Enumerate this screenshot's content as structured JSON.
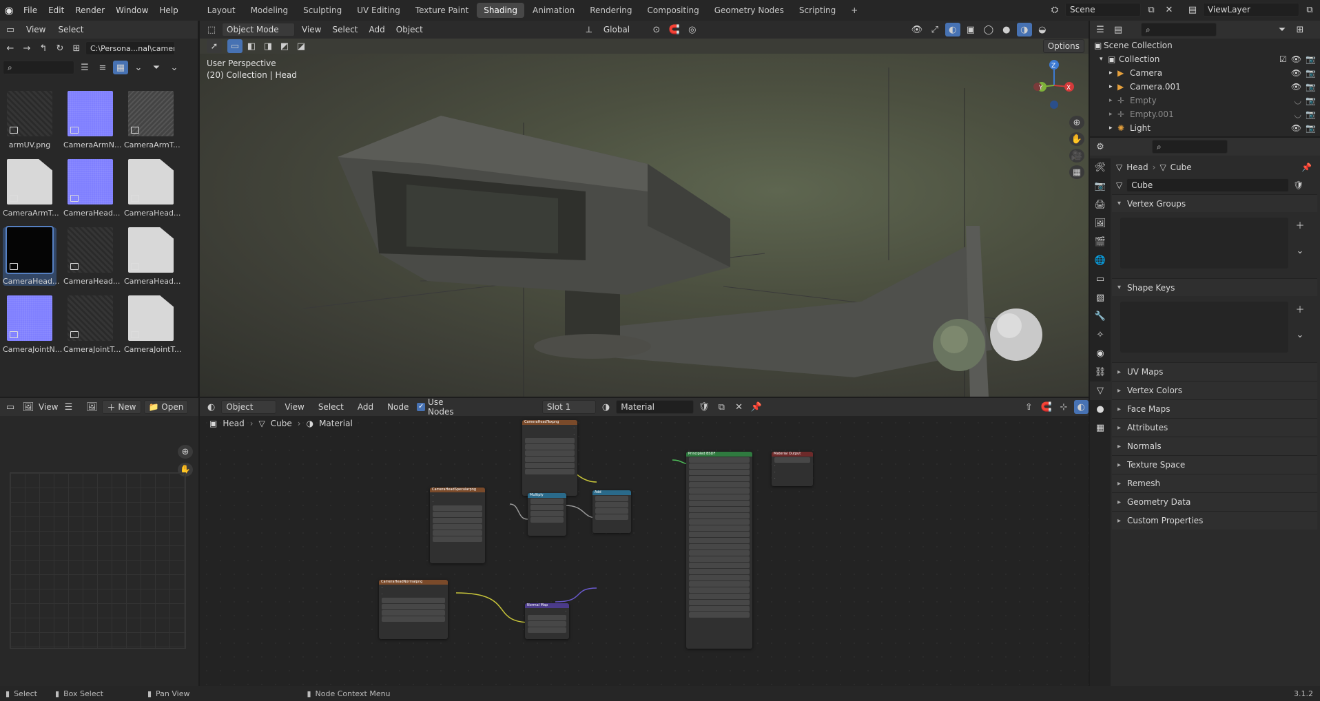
{
  "topbar": {
    "menus": [
      "File",
      "Edit",
      "Render",
      "Window",
      "Help"
    ],
    "workspaces": [
      "Layout",
      "Modeling",
      "Sculpting",
      "UV Editing",
      "Texture Paint",
      "Shading",
      "Animation",
      "Rendering",
      "Compositing",
      "Geometry Nodes",
      "Scripting"
    ],
    "active_workspace": "Shading",
    "add_tab": "+",
    "scene": "Scene",
    "view_layer": "ViewLayer"
  },
  "file_browser": {
    "menus": [
      "View",
      "Select"
    ],
    "path": "C:\\Persona...nal\\camera\\",
    "files": [
      {
        "name": "armUV.png",
        "kind": "dark"
      },
      {
        "name": "CameraArmN...",
        "kind": "normal"
      },
      {
        "name": "CameraArmT...",
        "kind": "greyish"
      },
      {
        "name": "CameraArmT...",
        "kind": "doc"
      },
      {
        "name": "CameraHead...",
        "kind": "normal"
      },
      {
        "name": "CameraHead...",
        "kind": "doc"
      },
      {
        "name": "CameraHead...",
        "kind": "selected"
      },
      {
        "name": "CameraHead...",
        "kind": "dark"
      },
      {
        "name": "CameraHead...",
        "kind": "doc"
      },
      {
        "name": "CameraJointN...",
        "kind": "normal"
      },
      {
        "name": "CameraJointT...",
        "kind": "dark"
      },
      {
        "name": "CameraJointT...",
        "kind": "doc"
      }
    ]
  },
  "viewport": {
    "mode": "Object Mode",
    "menus": [
      "View",
      "Select",
      "Add",
      "Object"
    ],
    "transform": "Global",
    "options": "Options",
    "overlay_line1": "User Perspective",
    "overlay_line2": "(20) Collection | Head",
    "axes": {
      "x": "X",
      "y": "Y",
      "z": "Z"
    }
  },
  "outliner": {
    "root": "Scene Collection",
    "collection": "Collection",
    "items": [
      {
        "name": "Camera",
        "dim": false,
        "icon": "camera-icon"
      },
      {
        "name": "Camera.001",
        "dim": false,
        "icon": "camera-icon"
      },
      {
        "name": "Empty",
        "dim": true,
        "icon": "empty-icon"
      },
      {
        "name": "Empty.001",
        "dim": true,
        "icon": "empty-icon"
      },
      {
        "name": "Light",
        "dim": false,
        "icon": "light-icon"
      }
    ]
  },
  "properties": {
    "breadcrumb_object": "Head",
    "breadcrumb_data": "Cube",
    "mesh_name": "Cube",
    "panels_open": [
      "Vertex Groups",
      "Shape Keys"
    ],
    "panels_closed": [
      "UV Maps",
      "Vertex Colors",
      "Face Maps",
      "Attributes",
      "Normals",
      "Texture Space",
      "Remesh",
      "Geometry Data",
      "Custom Properties"
    ]
  },
  "image_editor": {
    "menus": [
      "View"
    ],
    "new_label": "New",
    "open_label": "Open"
  },
  "node_editor": {
    "type": "Object",
    "menus": [
      "View",
      "Select",
      "Add",
      "Node"
    ],
    "use_nodes": "Use Nodes",
    "slot": "Slot 1",
    "material": "Material",
    "breadcrumb": [
      "Head",
      "Cube",
      "Material"
    ],
    "nodes": {
      "tex_top": "CameraHeadTexpng",
      "tex_mid": "CameraHeadSpecularpng",
      "tex_bottom": "CameraHeadNormalpng",
      "multiply": "Multiply",
      "add": "Add",
      "bsdf": "Principled BSDF",
      "output": "Material Output",
      "normal_map": "Normal Map"
    }
  },
  "statusbar": {
    "select": "Select",
    "box_select": "Box Select",
    "pan_view": "Pan View",
    "context_menu": "Node Context Menu",
    "version": "3.1.2"
  },
  "colors": {
    "accent": "#4772b3",
    "tex_node": "#7a4a2a",
    "shader_node": "#2f7a3f",
    "convert_node": "#2a6a8a",
    "vector_node": "#4b3b8a",
    "output_node": "#6e2a2a"
  }
}
